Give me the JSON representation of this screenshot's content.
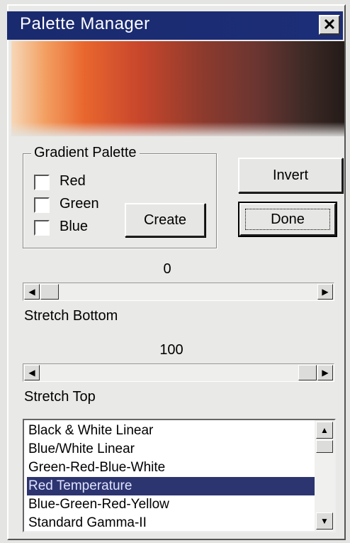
{
  "window": {
    "title": "Palette Manager",
    "close_glyph": "✕"
  },
  "gradient_group": {
    "label": "Gradient Palette",
    "options": [
      {
        "label": "Red",
        "checked": false
      },
      {
        "label": "Green",
        "checked": false
      },
      {
        "label": "Blue",
        "checked": false
      }
    ],
    "create_label": "Create"
  },
  "buttons": {
    "invert_label": "Invert",
    "done_label": "Done"
  },
  "stretch_bottom": {
    "value": "0",
    "label": "Stretch Bottom",
    "position_fraction": 0.0
  },
  "stretch_top": {
    "value": "100",
    "label": "Stretch Top",
    "position_fraction": 1.0
  },
  "palette_list": {
    "items": [
      "Black & White Linear",
      "Blue/White Linear",
      "Green-Red-Blue-White",
      "Red Temperature",
      "Blue-Green-Red-Yellow",
      "Standard Gamma-II"
    ],
    "selected_index": 3,
    "selected_color": "#2d3570"
  },
  "icons": {
    "left": "left-arrow-icon",
    "right": "right-arrow-icon",
    "up": "up-arrow-icon",
    "down": "down-arrow-icon"
  }
}
